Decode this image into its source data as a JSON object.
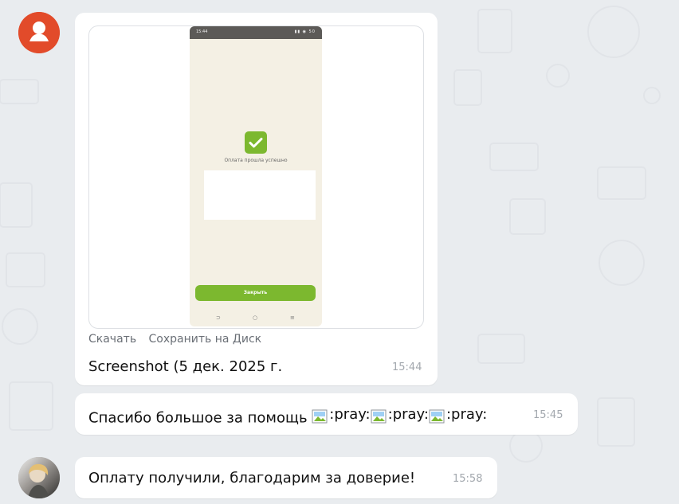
{
  "chat": {
    "background_color": "#e9ecef",
    "messages": [
      {
        "attachment": {
          "phone_status_time": "15:44",
          "phone_status_right": "▮▮ ◉ 50",
          "success_text": "Оплата прошла успешно",
          "close_button": "Закрыть"
        },
        "actions": {
          "download": "Скачать",
          "save_to_disk": "Сохранить на Диск"
        },
        "filename": "Screenshot (5 дек. 2025 г.",
        "time": "15:44"
      },
      {
        "text": "Спасибо большое за помощь",
        "emoji_texts": [
          ":pray:",
          ":pray:",
          ":pray:"
        ],
        "time": "15:45"
      },
      {
        "text": "Оплату получили, благодарим за доверие!",
        "time": "15:58"
      }
    ]
  },
  "colors": {
    "avatar_default": "#e24b2a",
    "phone_accent": "#7cb82f",
    "bubble": "#ffffff",
    "time_text": "#a3a8ae"
  }
}
